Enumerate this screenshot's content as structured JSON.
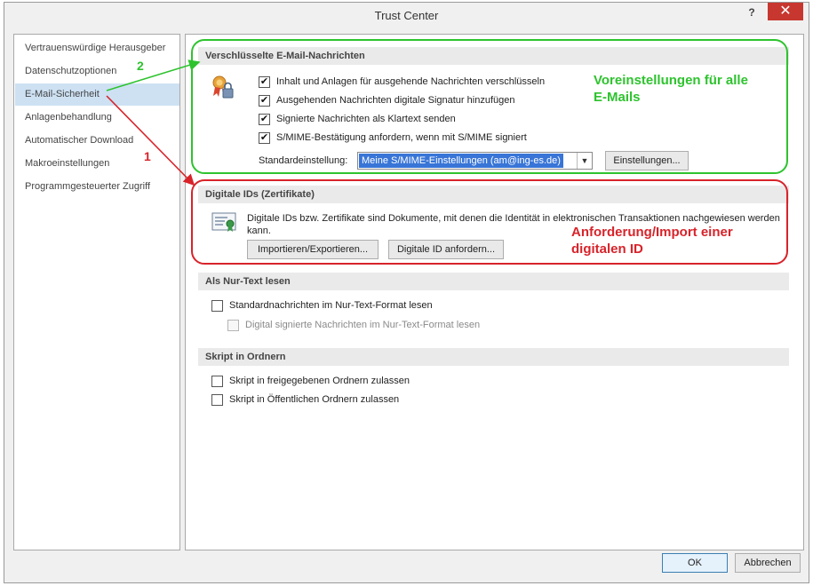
{
  "window": {
    "title": "Trust Center",
    "help_label": "?",
    "close_label": "✕"
  },
  "sidebar": {
    "items": [
      {
        "label": "Vertrauenswürdige Herausgeber"
      },
      {
        "label": "Datenschutzoptionen"
      },
      {
        "label": "E-Mail-Sicherheit",
        "selected": true
      },
      {
        "label": "Anlagenbehandlung"
      },
      {
        "label": "Automatischer Download"
      },
      {
        "label": "Makroeinstellungen"
      },
      {
        "label": "Programmgesteuerter Zugriff"
      }
    ]
  },
  "encrypted": {
    "header": "Verschlüsselte E-Mail-Nachrichten",
    "icon": "certificate-lock-icon",
    "options": [
      {
        "label": "Inhalt und Anlagen für ausgehende Nachrichten verschlüsseln",
        "checked": true
      },
      {
        "label": "Ausgehenden Nachrichten digitale Signatur hinzufügen",
        "checked": true
      },
      {
        "label": "Signierte Nachrichten als Klartext senden",
        "checked": true
      },
      {
        "label": "S/MIME-Bestätigung anfordern, wenn mit S/MIME signiert",
        "checked": true
      }
    ],
    "default_label": "Standardeinstellung:",
    "default_value": "Meine S/MIME-Einstellungen (am@ing-es.de)",
    "settings_button": "Einstellungen..."
  },
  "digital_ids": {
    "header": "Digitale IDs (Zertifikate)",
    "icon": "certificate-icon",
    "description": "Digitale IDs bzw. Zertifikate sind Dokumente, mit denen die Identität in elektronischen Transaktionen nachgewiesen werden kann.",
    "import_button": "Importieren/Exportieren...",
    "request_button": "Digitale ID anfordern..."
  },
  "plain_text": {
    "header": "Als Nur-Text lesen",
    "options": [
      {
        "label": "Standardnachrichten im Nur-Text-Format lesen",
        "checked": false,
        "enabled": true
      },
      {
        "label": "Digital signierte Nachrichten im Nur-Text-Format lesen",
        "checked": false,
        "enabled": false
      }
    ]
  },
  "script": {
    "header": "Skript in Ordnern",
    "options": [
      {
        "label": "Skript in freigegebenen Ordnern zulassen",
        "checked": false
      },
      {
        "label": "Skript in Öffentlichen Ordnern zulassen",
        "checked": false
      }
    ]
  },
  "footer": {
    "ok_label": "OK",
    "cancel_label": "Abbrechen"
  },
  "annotations": {
    "green_text_line1": "Voreinstellungen für alle",
    "green_text_line2": "E-Mails",
    "red_text_line1": "Anforderung/Import einer",
    "red_text_line2": "digitalen ID",
    "number_green": "2",
    "number_red": "1",
    "colors": {
      "green": "#2ec32e",
      "red": "#d8232a"
    }
  }
}
